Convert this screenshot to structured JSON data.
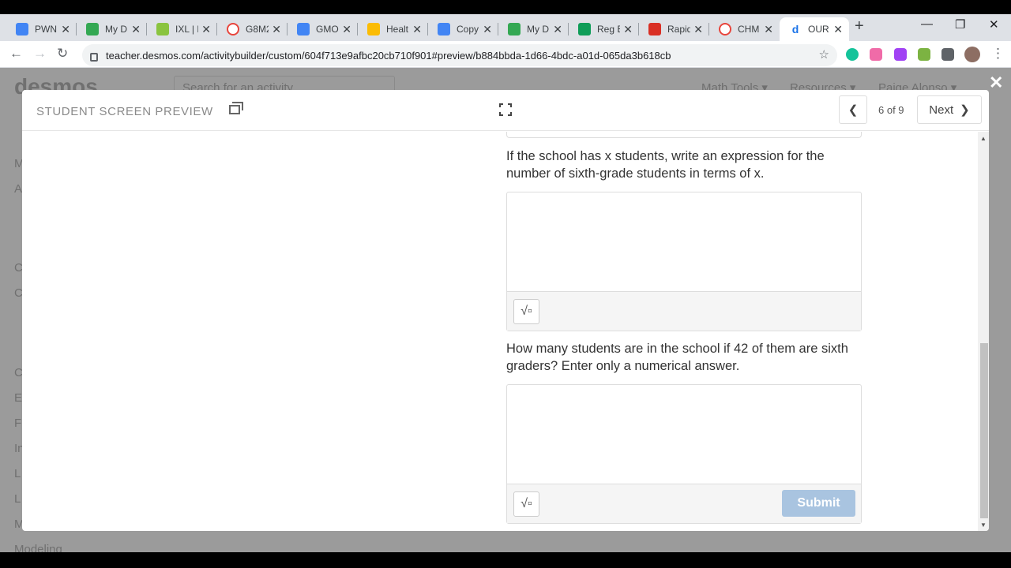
{
  "browser": {
    "tabs": [
      {
        "title": "PWN",
        "color": "#4285f4"
      },
      {
        "title": "My D",
        "color": "#34a853"
      },
      {
        "title": "IXL | L",
        "color": "#8ac43f"
      },
      {
        "title": "G8M2",
        "color": "#e8453c"
      },
      {
        "title": "GMO",
        "color": "#4285f4"
      },
      {
        "title": "Healt",
        "color": "#fbbc04"
      },
      {
        "title": "Copy",
        "color": "#4285f4"
      },
      {
        "title": "My D",
        "color": "#34a853"
      },
      {
        "title": "Reg E",
        "color": "#0f9d58"
      },
      {
        "title": "Rapid",
        "color": "#d93025"
      },
      {
        "title": "CHM",
        "color": "#e8453c"
      },
      {
        "title": "OUR",
        "color": "#1a73e8"
      }
    ],
    "url": "teacher.desmos.com/activitybuilder/custom/604f713e9afbc20cb710f901#preview/b884bbda-1d66-4bdc-a01d-065da3b618cb"
  },
  "background": {
    "logo": "desmos",
    "search_placeholder": "Search for an activity",
    "menu": [
      "Math Tools ▾",
      "Resources ▾",
      "Paige Alonso ▾"
    ],
    "left_items": [
      "M",
      "A",
      "C",
      "C",
      "C",
      "E",
      "F",
      "In",
      "L",
      "L",
      "M",
      "Modeling"
    ]
  },
  "preview": {
    "title": "STUDENT SCREEN PREVIEW",
    "counter": "6 of 9",
    "next_label": "Next",
    "questions": [
      {
        "text": "If the school has x students, write an expression for the number of sixth-grade students in terms of x.",
        "value": ""
      },
      {
        "text": "How many students are in the school if 42 of them are sixth graders? Enter only a numerical answer.",
        "value": ""
      }
    ],
    "sqrt_label": "√▫",
    "submit_label": "Submit"
  }
}
